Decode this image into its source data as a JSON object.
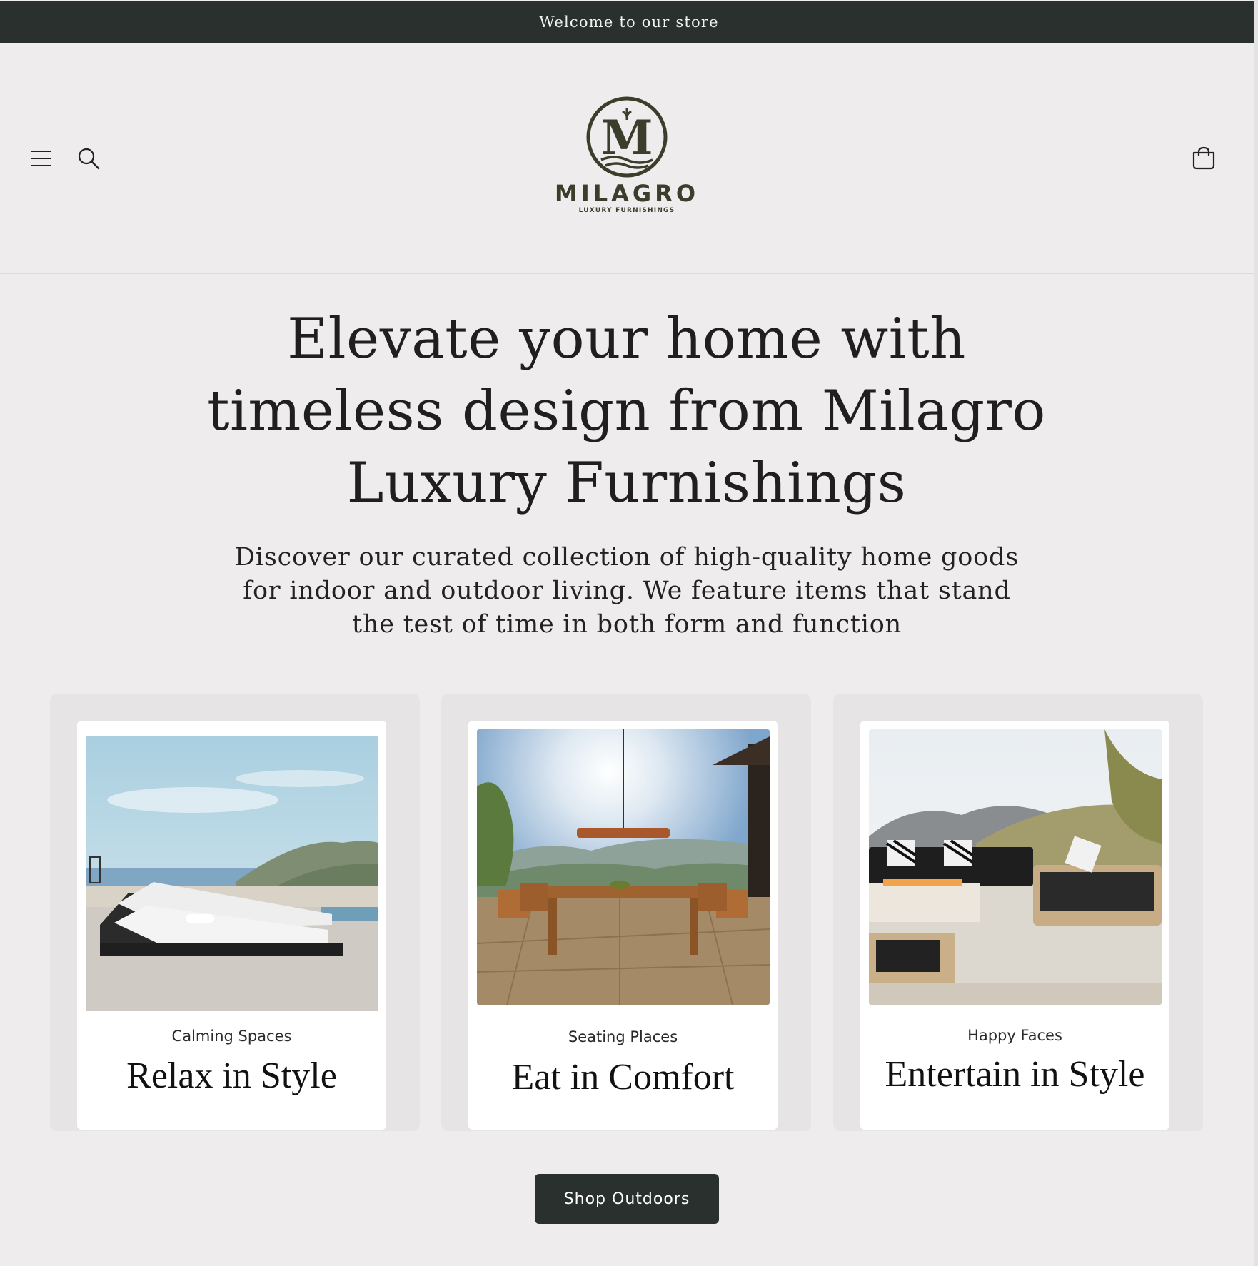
{
  "announcement": {
    "text": "Welcome to our store"
  },
  "header": {
    "logo": {
      "monogram": "M",
      "wordmark": "MILAGRO",
      "tagline": "LUXURY FURNISHINGS"
    },
    "icons": {
      "menu": "hamburger-menu-icon",
      "search": "search-icon",
      "cart": "cart-icon"
    }
  },
  "hero": {
    "title_lines": [
      "Elevate your home with",
      "timeless design from Milagro",
      "Luxury Furnishings"
    ],
    "subtitle_lines": [
      "Discover our curated collection of high-quality home goods",
      "for indoor and outdoor living. We feature items that stand",
      "the test of time in both form and function"
    ]
  },
  "cards": [
    {
      "eyebrow": "Calming Spaces",
      "heading": "Relax in Style",
      "image": "poolside chaise lounges overlooking ocean"
    },
    {
      "eyebrow": "Seating Places",
      "heading": "Eat in Comfort",
      "image": "outdoor wooden dining table on patio"
    },
    {
      "eyebrow": "Happy Faces",
      "heading": "Entertain in Style",
      "image": "outdoor sofa set with fire pit"
    }
  ],
  "cta": {
    "label": "Shop Outdoors"
  },
  "colors": {
    "announcement_bg": "#2a302d",
    "page_bg": "#eeecec",
    "card_bg": "#e6e4e4",
    "button_bg": "#2a302d",
    "logo": "#3a3e2b"
  }
}
